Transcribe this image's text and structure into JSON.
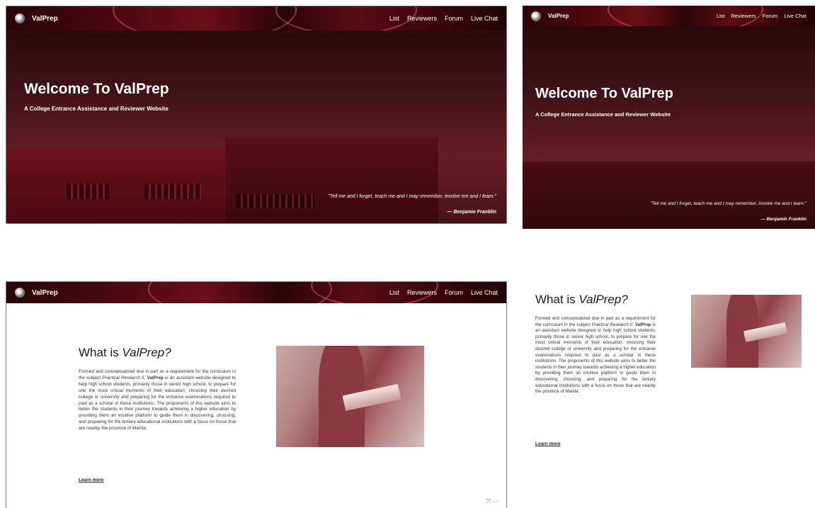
{
  "nav": {
    "brand": "ValPrep",
    "links": [
      "List",
      "Reviewers",
      "Forum",
      "Live Chat"
    ]
  },
  "hero": {
    "title": "Welcome To ValPrep",
    "subtitle": "A College Entrance Assistance and Reviewer Website",
    "quote": "\"Tell me and I forget, teach me and I may remember, involve me and I learn.\"",
    "author": "— Benjamin Franklin"
  },
  "about": {
    "title_prefix": "What is ",
    "title_em": "ValPrep?",
    "p_part1": "Formed and conceptualized due in part as a requirement for the curriculum in the subject ",
    "p_em": "Practical Research II",
    "p_part2": ", ",
    "p_strong": "ValPrep",
    "p_part3": " is an assistant website designed to help high school students, primarily those in senior high school, to prepare for one the most critical moments of their education; choosing their desired college or university and preparing for the entrance examinations required to past as a scholar in these institutions. The proponents of this website aims to better the students in their journey towards achieving a higher education by providing them an intuitive platform to guide them in discovering, choosing, and preparing for the tertiary educational institutions with a focus on those that are nearby the province of Manila.",
    "learn_more": "Learn more"
  },
  "corner_icons": "⤧  ⋯",
  "colors": {
    "nav_dark": "#2a0407",
    "accent": "#6c0f17"
  }
}
